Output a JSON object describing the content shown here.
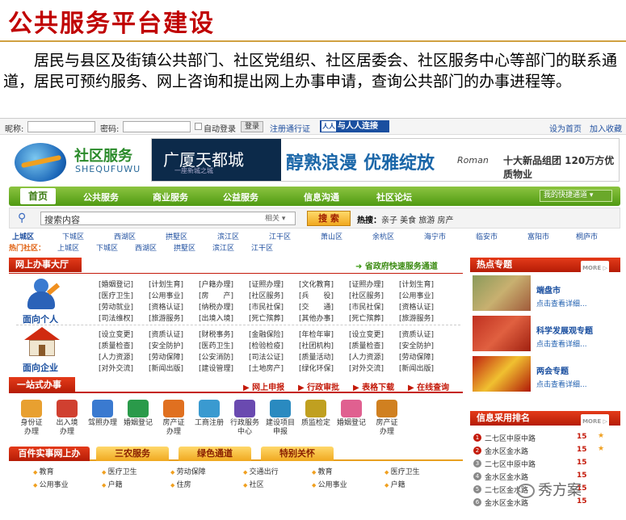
{
  "slide": {
    "title": "公共服务平台建设",
    "description": "居民与县区及街镇公共部门、社区党组织、社区居委会、社区服务中心等部门的联系通道，居民可预约服务、网上咨询和提出网上办事申请，查询公共部门的办事进程等。"
  },
  "loginbar": {
    "nickname_label": "昵称:",
    "password_label": "密码:",
    "remember_label": "自动登录",
    "login_button": "登录",
    "register_link": "注册通行证",
    "badge_logo": "人人",
    "badge_text": "与人人连接",
    "homepage_link": "设为首页",
    "favorite_link": "加入收藏"
  },
  "header": {
    "brand_cn": "社区服务",
    "brand_pinyin": "SHEQUFUWU",
    "ad_left": "广厦天都城",
    "ad_left_sub": "一座新城之城",
    "ad_slogan1": "醇熟浪漫",
    "ad_slogan2": "优雅绽放",
    "ad_roman": "Roman",
    "ad_promo": "十大新品组团  120万方优质物业"
  },
  "nav": {
    "home": "首页",
    "items": [
      "公共服务",
      "商业服务",
      "公益服务",
      "信息沟通",
      "社区论坛"
    ],
    "quick": "我的快捷通道 ▾"
  },
  "search": {
    "placeholder": "搜索内容",
    "select": "相关 ▾",
    "button": "搜 索",
    "hot_label": "热搜：",
    "hot_items": "亲子  美食  旅游  房产"
  },
  "regions": {
    "row1_head": "上城区",
    "row1": [
      "下城区",
      "西湖区",
      "拱墅区",
      "滨江区",
      "江干区",
      "萧山区",
      "余杭区",
      "海宁市",
      "临安市",
      "富阳市",
      "桐庐市"
    ],
    "row2_head": "热门社区：",
    "row2": [
      "上城区",
      "下城区",
      "西湖区",
      "拱墅区",
      "滨江区",
      "江干区"
    ]
  },
  "online": {
    "title": "网上办事大厅",
    "gov_link": "省政府快速服务通道",
    "personal_label": "面向个人",
    "enterprise_label": "面向企业",
    "personal_items": [
      "[婚姻登记]",
      "[计划生育]",
      "[户籍办理]",
      "[证照办理]",
      "[文化教育]",
      "[证照办理]",
      "[计划生育]",
      "[医疗卫生]",
      "[公用事业]",
      "[房　　产]",
      "[社区服务]",
      "[兵　　役]",
      "[社区服务]",
      "[公用事业]",
      "[劳动就业]",
      "[资格认证]",
      "[纳税办理]",
      "[市民社保]",
      "[交　　通]",
      "[市民社保]",
      "[资格认证]",
      "[司法维权]",
      "[旅游服务]",
      "[出境入境]",
      "[死亡殡葬]",
      "[其他办事]",
      "[死亡殡葬]",
      "[旅游服务]"
    ],
    "enterprise_items": [
      "[设立变更]",
      "[资质认证]",
      "[财税事务]",
      "[金融保险]",
      "[年检年审]",
      "[设立变更]",
      "[资质认证]",
      "[质量检查]",
      "[安全防护]",
      "[医药卫生]",
      "[检验检疫]",
      "[社团机构]",
      "[质量检查]",
      "[安全防护]",
      "[人力资源]",
      "[劳动保障]",
      "[公安消防]",
      "[司法公证]",
      "[质量活动]",
      "[人力资源]",
      "[劳动保障]",
      "[对外交流]",
      "[新闻出版]",
      "[建设管理]",
      "[土地房产]",
      "[绿化环保]",
      "[对外交流]",
      "[新闻出版]"
    ]
  },
  "onestop": {
    "title": "一站式办事",
    "links": [
      "网上申报",
      "行政审批",
      "表格下载",
      "在线查询"
    ],
    "services": [
      "身份证\n办理",
      "出入境\n办理",
      "驾照办理",
      "婚姻登记",
      "房产证\n办理",
      "工商注册",
      "行政服务\n中心",
      "建设项目\n申报",
      "质监检定",
      "婚姻登记",
      "房产证\n办理"
    ]
  },
  "tabs": [
    "百件实事网上办",
    "三农服务",
    "绿色通道",
    "特别关怀"
  ],
  "bottom_items": [
    "教育",
    "医疗卫生",
    "劳动保障",
    "交通出行",
    "教育",
    "医疗卫生",
    "公用事业",
    "户籍",
    "住房",
    "社区",
    "公用事业",
    "户籍"
  ],
  "hot": {
    "title": "热点专题",
    "more": "MORE ▷",
    "items": [
      {
        "title": "端盘市",
        "link": "点击查看详细..."
      },
      {
        "title": "科学发展观专题",
        "link": "点击查看详细..."
      },
      {
        "title": "两会专题",
        "link": "点击查看详细..."
      }
    ]
  },
  "ranking": {
    "title": "信息采用排名",
    "more": "MORE ▷",
    "rows": [
      {
        "n": "1",
        "name": "二七区中原中路",
        "count": "15",
        "star": "★"
      },
      {
        "n": "2",
        "name": "金水区金水路",
        "count": "15",
        "star": "★"
      },
      {
        "n": "3",
        "name": "二七区中原中路",
        "count": "15",
        "star": ""
      },
      {
        "n": "4",
        "name": "金水区金水路",
        "count": "15",
        "star": ""
      },
      {
        "n": "5",
        "name": "二七区金水路",
        "count": "15",
        "star": ""
      },
      {
        "n": "6",
        "name": "金水区金水路",
        "count": "15",
        "star": ""
      }
    ]
  },
  "watermark": "秀方案",
  "colors": {
    "title_red": "#c00000",
    "nav_green": "#5aa31a",
    "panel_red": "#c41a0a",
    "link_blue": "#2050a0"
  }
}
